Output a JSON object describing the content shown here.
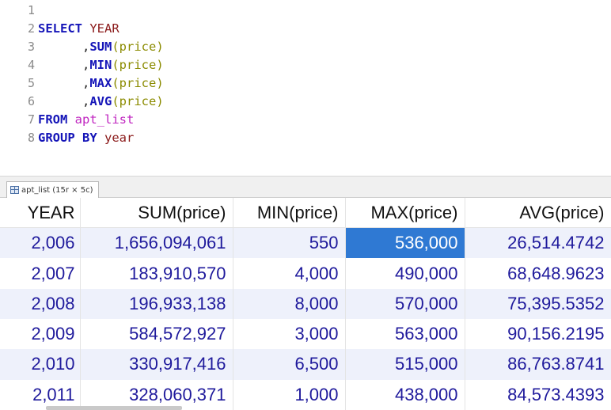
{
  "editor": {
    "lines": [
      {
        "num": "1",
        "tokens": []
      },
      {
        "num": "2",
        "tokens": [
          {
            "t": "SELECT ",
            "c": "kw"
          },
          {
            "t": "YEAR",
            "c": "id"
          }
        ]
      },
      {
        "num": "3",
        "tokens": [
          {
            "t": "      ,",
            "c": "pu"
          },
          {
            "t": "SUM",
            "c": "fn"
          },
          {
            "t": "(price)",
            "c": "pn"
          }
        ]
      },
      {
        "num": "4",
        "tokens": [
          {
            "t": "      ,",
            "c": "pu"
          },
          {
            "t": "MIN",
            "c": "fn"
          },
          {
            "t": "(price)",
            "c": "pn"
          }
        ]
      },
      {
        "num": "5",
        "tokens": [
          {
            "t": "      ,",
            "c": "pu"
          },
          {
            "t": "MAX",
            "c": "fn"
          },
          {
            "t": "(price)",
            "c": "pn"
          }
        ]
      },
      {
        "num": "6",
        "tokens": [
          {
            "t": "      ,",
            "c": "pu"
          },
          {
            "t": "AVG",
            "c": "fn"
          },
          {
            "t": "(price)",
            "c": "pn"
          }
        ]
      },
      {
        "num": "7",
        "tokens": [
          {
            "t": "FROM ",
            "c": "kw"
          },
          {
            "t": "apt_list",
            "c": "tb"
          }
        ]
      },
      {
        "num": "8",
        "tokens": [
          {
            "t": "GROUP BY ",
            "c": "kw"
          },
          {
            "t": "year",
            "c": "id"
          }
        ]
      }
    ]
  },
  "result_tab": {
    "label": "apt_list (15r × 5c)",
    "icon": "grid-icon"
  },
  "grid": {
    "columns": [
      "YEAR",
      "SUM(price)",
      "MIN(price)",
      "MAX(price)",
      "AVG(price)"
    ],
    "rows": [
      [
        "2,006",
        "1,656,094,061",
        "550",
        "536,000",
        "26,514.4742"
      ],
      [
        "2,007",
        "183,910,570",
        "4,000",
        "490,000",
        "68,648.9623"
      ],
      [
        "2,008",
        "196,933,138",
        "8,000",
        "570,000",
        "75,395.5352"
      ],
      [
        "2,009",
        "584,572,927",
        "3,000",
        "563,000",
        "90,156.2195"
      ],
      [
        "2,010",
        "330,917,416",
        "6,500",
        "515,000",
        "86,763.8741"
      ],
      [
        "2,011",
        "328,060,371",
        "1,000",
        "438,000",
        "84,573.4393"
      ]
    ],
    "selected_cell": {
      "row": 0,
      "col": 3
    }
  },
  "colors": {
    "keyword": "#1515b8",
    "identifier": "#8b1a1a",
    "table_name": "#c026c0",
    "selection": "#2f79d3",
    "cell_text": "#1f1a9c"
  }
}
